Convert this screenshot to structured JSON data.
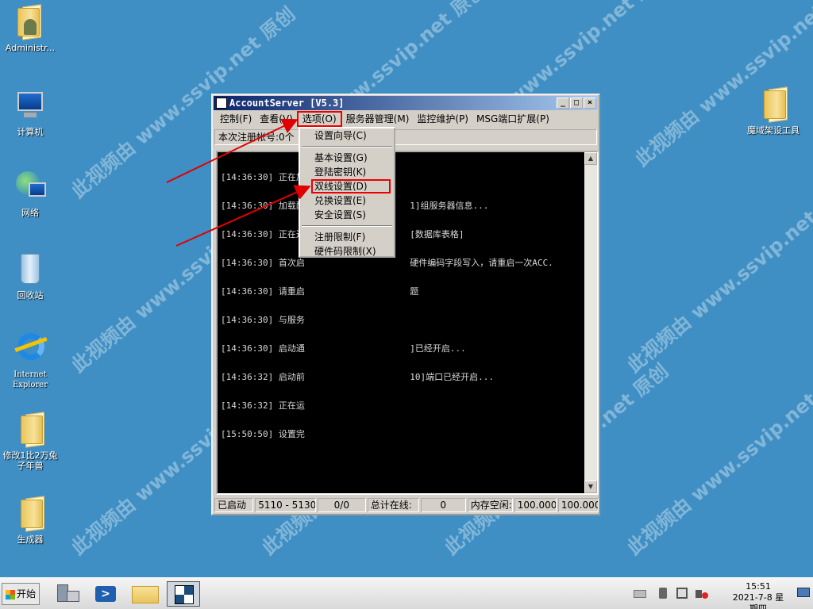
{
  "watermark": "此视频由 www.ssvip.net 原创",
  "desktop": {
    "icons": [
      {
        "label": "Administr..."
      },
      {
        "label": "计算机"
      },
      {
        "label": "网络"
      },
      {
        "label": "回收站"
      },
      {
        "label": "Internet Explorer"
      },
      {
        "label": "修改1比2万兔子年兽"
      },
      {
        "label": "生成器"
      },
      {
        "label": "魔域架设工具"
      }
    ]
  },
  "window": {
    "title": "AccountServer [V5.3]",
    "menu": [
      "控制(F)",
      "查看(V)",
      "选项(O)",
      "服务器管理(M)",
      "监控维护(P)",
      "MSG端口扩展(P)"
    ],
    "info": "本次注册帐号:0个",
    "log_lines": [
      "[14:36:30] 正在加",
      "[14:36:30] 加载配                    1]组服务器信息...",
      "[14:36:30] 正在进                    [数据库表格]",
      "[14:36:30] 首次启                    硬件编码字段写入，请重启一次ACC.",
      "[14:36:30] 请重启                    题",
      "[14:36:30] 与服务",
      "[14:36:30] 启动通                    ]已经开启...",
      "[14:36:32] 启动前                    10]端口已经开启...",
      "[14:36:32] 正在运",
      "[15:50:50] 设置完"
    ],
    "status": [
      "已启动",
      "5110 - 5130",
      "0/0",
      "总计在线:",
      "0",
      "内存空闲:",
      "100.000%",
      "100.000%"
    ]
  },
  "dropdown": {
    "items": [
      "设置向导(C)",
      "基本设置(G)",
      "登陆密钥(K)",
      "双线设置(D)",
      "兑换设置(E)",
      "安全设置(S)",
      "注册限制(F)",
      "硬件码限制(X)"
    ]
  },
  "taskbar": {
    "start": "开始",
    "time": "15:51",
    "date": "2021-7-8 星期四"
  },
  "colors": {
    "desktop": "#3f8fc4",
    "highlight": "#e00000",
    "titlebar": "#0a246a"
  }
}
